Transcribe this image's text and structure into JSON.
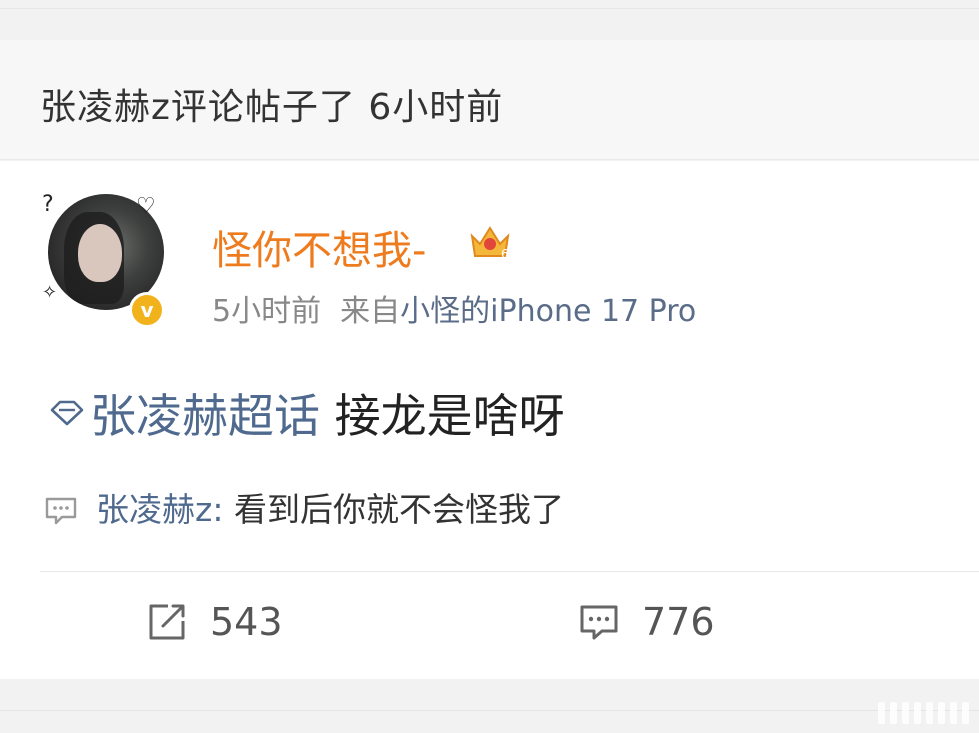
{
  "header": {
    "text": "张凌赫z评论帖子了 6小时前"
  },
  "post": {
    "user": {
      "name": "怪你不想我-",
      "verified": true,
      "badge_level": "6"
    },
    "meta": {
      "time": "5小时前",
      "from_label": "来自",
      "device": "小怪的iPhone 17 Pro"
    },
    "topic": "张凌赫超话",
    "content": "接龙是啥呀",
    "top_comment": {
      "author": "张凌赫z:",
      "text": "看到后你就不会怪我了"
    },
    "actions": {
      "repost_count": "543",
      "comment_count": "776"
    }
  },
  "colors": {
    "username": "#ee7b1e",
    "link": "#4f6a8e",
    "verified_badge": "#f2b21c"
  }
}
